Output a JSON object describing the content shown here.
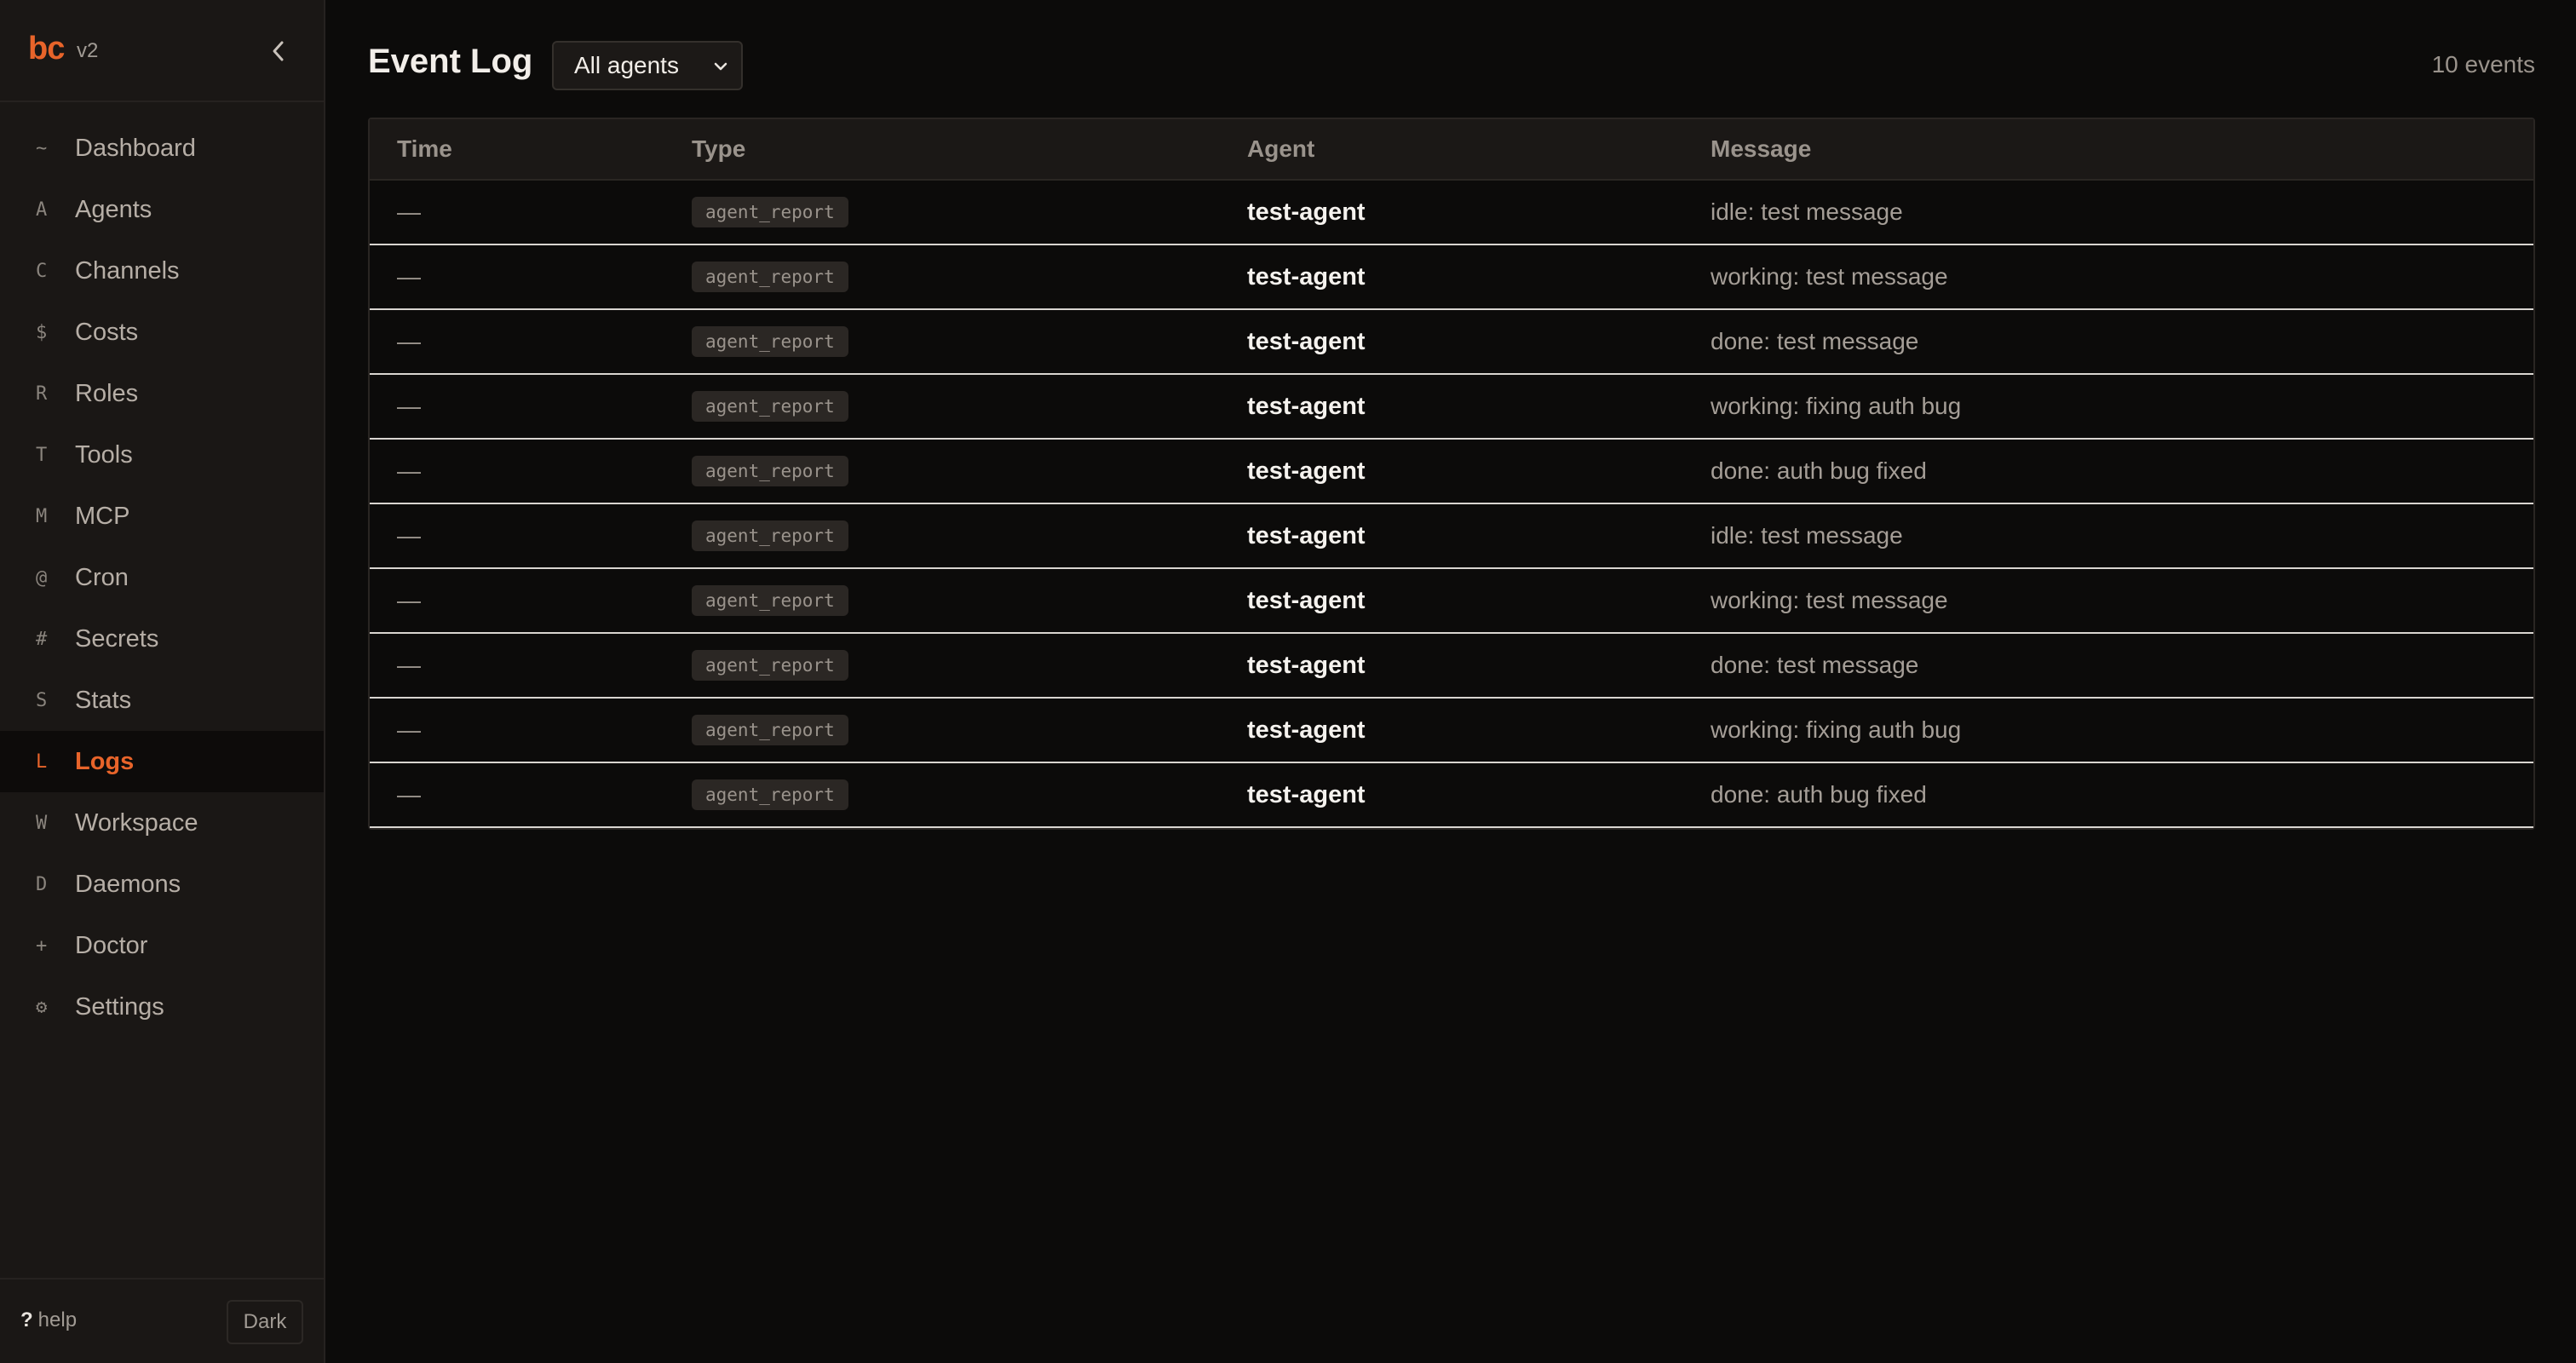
{
  "app": {
    "logo": "bc",
    "version": "v2"
  },
  "sidebar": {
    "items": [
      {
        "key": "~",
        "label": "Dashboard"
      },
      {
        "key": "A",
        "label": "Agents"
      },
      {
        "key": "C",
        "label": "Channels"
      },
      {
        "key": "$",
        "label": "Costs"
      },
      {
        "key": "R",
        "label": "Roles"
      },
      {
        "key": "T",
        "label": "Tools"
      },
      {
        "key": "M",
        "label": "MCP"
      },
      {
        "key": "@",
        "label": "Cron"
      },
      {
        "key": "#",
        "label": "Secrets"
      },
      {
        "key": "S",
        "label": "Stats"
      },
      {
        "key": "L",
        "label": "Logs",
        "active": true
      },
      {
        "key": "W",
        "label": "Workspace"
      },
      {
        "key": "D",
        "label": "Daemons"
      },
      {
        "key": "+",
        "label": "Doctor"
      },
      {
        "key": "⚙",
        "label": "Settings"
      }
    ],
    "footer": {
      "help_mark": "?",
      "help_label": "help",
      "theme_label": "Dark"
    }
  },
  "main": {
    "title": "Event Log",
    "filter": {
      "selected": "All agents"
    },
    "event_count": "10 events",
    "columns": [
      "Time",
      "Type",
      "Agent",
      "Message"
    ],
    "rows": [
      {
        "time": "—",
        "type": "agent_report",
        "agent": "test-agent",
        "message": "idle: test message"
      },
      {
        "time": "—",
        "type": "agent_report",
        "agent": "test-agent",
        "message": "working: test message"
      },
      {
        "time": "—",
        "type": "agent_report",
        "agent": "test-agent",
        "message": "done: test message"
      },
      {
        "time": "—",
        "type": "agent_report",
        "agent": "test-agent",
        "message": "working: fixing auth bug"
      },
      {
        "time": "—",
        "type": "agent_report",
        "agent": "test-agent",
        "message": "done: auth bug fixed"
      },
      {
        "time": "—",
        "type": "agent_report",
        "agent": "test-agent",
        "message": "idle: test message"
      },
      {
        "time": "—",
        "type": "agent_report",
        "agent": "test-agent",
        "message": "working: test message"
      },
      {
        "time": "—",
        "type": "agent_report",
        "agent": "test-agent",
        "message": "done: test message"
      },
      {
        "time": "—",
        "type": "agent_report",
        "agent": "test-agent",
        "message": "working: fixing auth bug"
      },
      {
        "time": "—",
        "type": "agent_report",
        "agent": "test-agent",
        "message": "done: auth bug fixed"
      }
    ]
  },
  "colors": {
    "accent": "#e8642a",
    "background": "#0c0b0a",
    "sidebar": "#1a1715"
  }
}
